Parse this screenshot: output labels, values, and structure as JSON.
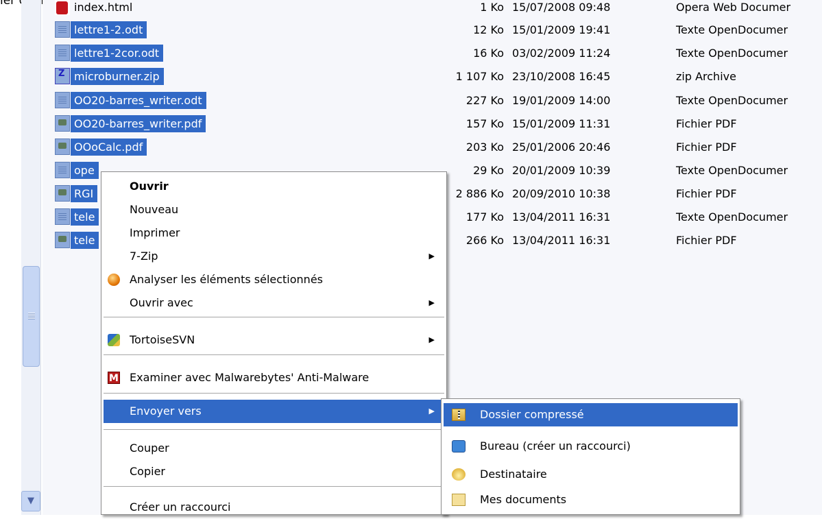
{
  "caption": "ier compressé.",
  "files": [
    {
      "name": "index.html",
      "icon": "opera-icon",
      "size": "1 Ko",
      "date": "15/07/2008 09:48",
      "type": "Opera Web Documer",
      "selected": false
    },
    {
      "name": "lettre1-2.odt",
      "icon": "document-icon",
      "size": "12 Ko",
      "date": "15/01/2009 19:41",
      "type": "Texte OpenDocumer",
      "selected": true
    },
    {
      "name": "lettre1-2cor.odt",
      "icon": "document-icon",
      "size": "16 Ko",
      "date": "03/02/2009 11:24",
      "type": "Texte OpenDocumer",
      "selected": true
    },
    {
      "name": "microburner.zip",
      "icon": "zip-icon",
      "size": "1 107 Ko",
      "date": "23/10/2008 16:45",
      "type": "zip Archive",
      "selected": true
    },
    {
      "name": "OO20-barres_writer.odt",
      "icon": "document-icon",
      "size": "227 Ko",
      "date": "19/01/2009 14:00",
      "type": "Texte OpenDocumer",
      "selected": true
    },
    {
      "name": "OO20-barres_writer.pdf",
      "icon": "pdf-icon",
      "size": "157 Ko",
      "date": "15/01/2009 11:31",
      "type": "Fichier PDF",
      "selected": true
    },
    {
      "name": "OOoCalc.pdf",
      "icon": "pdf-icon",
      "size": "203 Ko",
      "date": "25/01/2006 20:46",
      "type": "Fichier PDF",
      "selected": true
    },
    {
      "name": "ope",
      "icon": "document-icon",
      "size": "29 Ko",
      "date": "20/01/2009 10:39",
      "type": "Texte OpenDocumer",
      "selected": true
    },
    {
      "name": "RGI",
      "icon": "pdf-icon",
      "size": "2 886 Ko",
      "date": "20/09/2010 10:38",
      "type": "Fichier PDF",
      "selected": true
    },
    {
      "name": "tele",
      "icon": "document-icon",
      "size": "177 Ko",
      "date": "13/04/2011 16:31",
      "type": "Texte OpenDocumer",
      "selected": true
    },
    {
      "name": "tele",
      "icon": "pdf-icon",
      "size": "266 Ko",
      "date": "13/04/2011 16:31",
      "type": "Fichier PDF",
      "selected": true
    }
  ],
  "context_menu": {
    "open": "Ouvrir",
    "new": "Nouveau",
    "print": "Imprimer",
    "zip7": "7-Zip",
    "analyse": "Analyser les éléments sélectionnés",
    "open_with": "Ouvrir avec",
    "tortoise": "TortoiseSVN",
    "malwarebytes": "Examiner avec Malwarebytes' Anti-Malware",
    "send_to": "Envoyer vers",
    "cut": "Couper",
    "copy": "Copier",
    "create_shortcut": "Créer un raccourci"
  },
  "send_to_menu": {
    "compressed": "Dossier compressé",
    "desktop": "Bureau (créer un raccourci)",
    "recipient": "Destinataire",
    "my_documents": "Mes documents"
  },
  "colors": {
    "selection": "#3169c6",
    "list_background": "#f6f7fb"
  }
}
